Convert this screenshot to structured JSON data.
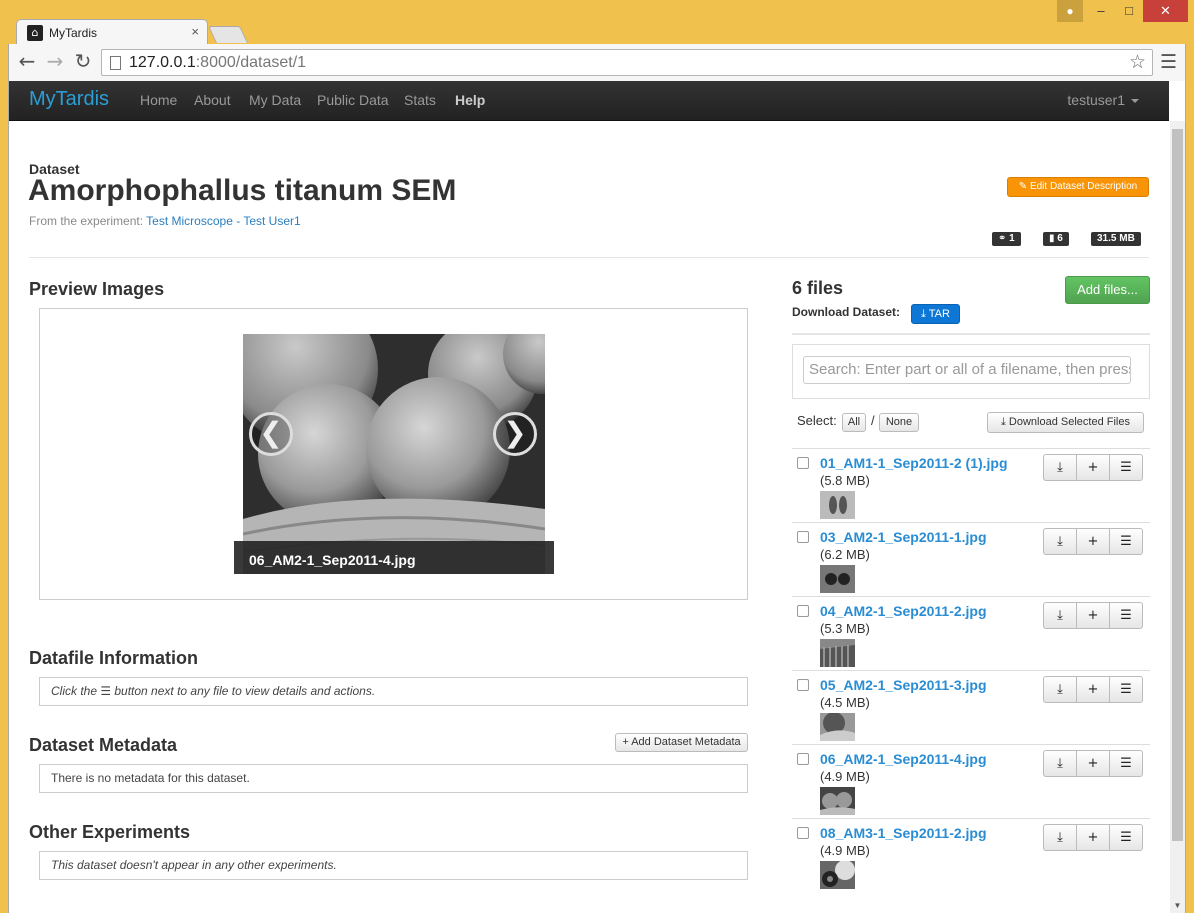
{
  "browser": {
    "tab_title": "MyTardis",
    "favicon_glyph": "⌂",
    "url_host": "127.0.0.1",
    "url_path": ":8000/dataset/1"
  },
  "navbar": {
    "brand": "MyTardis",
    "links": [
      "Home",
      "About",
      "My Data",
      "Public Data",
      "Stats",
      "Help"
    ],
    "user": "testuser1"
  },
  "dataset": {
    "label": "Dataset",
    "title": "Amorphophallus titanum SEM",
    "from_prefix": "From the experiment: ",
    "experiment_link": "Test Microscope - Test User1",
    "edit_button": "✎ Edit Dataset Description",
    "badges": {
      "experiments": "⚭ 1",
      "files": "▮ 6",
      "size": "31.5 MB"
    }
  },
  "preview": {
    "title": "Preview Images",
    "caption": "06_AM2-1_Sep2011-4.jpg",
    "prev": "❮",
    "next": "❯"
  },
  "datafile_info": {
    "title": "Datafile Information",
    "text": "Click the ☰ button next to any file to view details and actions."
  },
  "metadata": {
    "title": "Dataset Metadata",
    "add_button": "+ Add Dataset Metadata",
    "text": "There is no metadata for this dataset."
  },
  "other_experiments": {
    "title": "Other Experiments",
    "text": "This dataset doesn't appear in any other experiments."
  },
  "files": {
    "count_title": "6 files",
    "download_label": "Download Dataset:",
    "tar_button": "⤓ TAR",
    "add_button": "Add files...",
    "search_placeholder": "Search: Enter part or all of a filename, then press Enter",
    "select_label": "Select:",
    "select_all": "All",
    "select_sep": "/",
    "select_none": "None",
    "download_selected": "⤓ Download Selected Files",
    "list": [
      {
        "name": "01_AM1-1_Sep2011-2 (1).jpg",
        "size": "(5.8 MB)"
      },
      {
        "name": "03_AM2-1_Sep2011-1.jpg",
        "size": "(6.2 MB)"
      },
      {
        "name": "04_AM2-1_Sep2011-2.jpg",
        "size": "(5.3 MB)"
      },
      {
        "name": "05_AM2-1_Sep2011-3.jpg",
        "size": "(4.5 MB)"
      },
      {
        "name": "06_AM2-1_Sep2011-4.jpg",
        "size": "(4.9 MB)"
      },
      {
        "name": "08_AM3-1_Sep2011-2.jpg",
        "size": "(4.9 MB)"
      }
    ],
    "row_buttons": {
      "download": "⤓",
      "add": "+",
      "details": "☰"
    }
  }
}
